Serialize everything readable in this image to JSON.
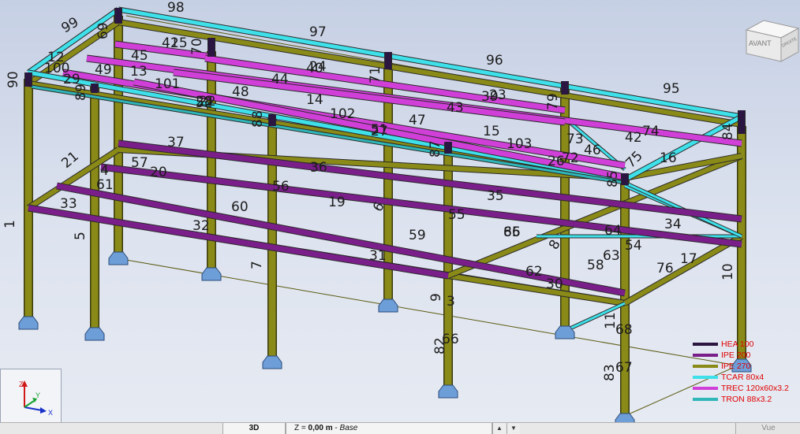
{
  "viewcube": {
    "front_label": "AVANT",
    "right_label": "DROITE"
  },
  "axes": {
    "z": "Z",
    "y": "Y",
    "x": "X"
  },
  "legend": [
    {
      "label": "HEA 100",
      "color": "#2a1640"
    },
    {
      "label": "IPE 200",
      "color": "#7a1f8a"
    },
    {
      "label": "IPE 270",
      "color": "#8a8a18"
    },
    {
      "label": "TCAR 80x4",
      "color": "#3ee0ea"
    },
    {
      "label": "TREC 120x60x3.2",
      "color": "#d040d8"
    },
    {
      "label": "TRON 88x3.2",
      "color": "#2fb6b8"
    }
  ],
  "bar_numbers": [
    "1",
    "3",
    "4",
    "5",
    "6",
    "7",
    "8",
    "9",
    "10",
    "11",
    "12",
    "13",
    "14",
    "15",
    "16",
    "17",
    "19",
    "20",
    "21",
    "22",
    "23",
    "24",
    "25",
    "26",
    "27",
    "28",
    "29",
    "30",
    "31",
    "32",
    "33",
    "34",
    "35",
    "36",
    "37",
    "39",
    "40",
    "41",
    "42",
    "43",
    "44",
    "45",
    "46",
    "47",
    "48",
    "49",
    "51",
    "52",
    "54",
    "55",
    "56",
    "57",
    "58",
    "59",
    "60",
    "61",
    "62",
    "63",
    "64",
    "65",
    "66",
    "67",
    "68",
    "69",
    "70",
    "71",
    "72",
    "73",
    "74",
    "75",
    "76",
    "79",
    "82",
    "83",
    "84",
    "85",
    "86",
    "87",
    "88",
    "89",
    "90",
    "95",
    "96",
    "97",
    "98",
    "99",
    "100",
    "101",
    "102",
    "103"
  ],
  "statusbar": {
    "view_mode": "3D",
    "level_prefix": "Z = ",
    "level_value": "0,00 m",
    "level_separator": " - ",
    "level_name": "Base",
    "view_label": "Vue"
  }
}
